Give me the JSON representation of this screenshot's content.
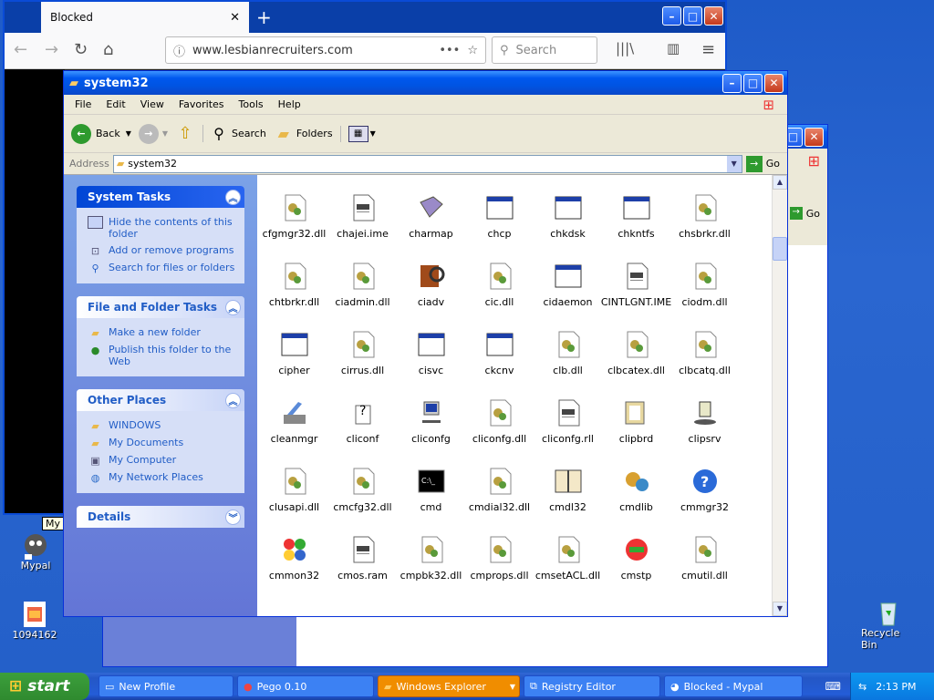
{
  "browser": {
    "tab_title": "Blocked",
    "url": "www.lesbianrecruiters.com",
    "search_placeholder": "Search"
  },
  "explorer": {
    "title": "system32",
    "menu": [
      "File",
      "Edit",
      "View",
      "Favorites",
      "Tools",
      "Help"
    ],
    "toolbar": {
      "back": "Back",
      "search": "Search",
      "folders": "Folders"
    },
    "address_label": "Address",
    "address_value": "system32",
    "go": "Go",
    "panels": {
      "system_tasks": {
        "title": "System Tasks",
        "items": [
          "Hide the contents of this folder",
          "Add or remove programs",
          "Search for files or folders"
        ]
      },
      "file_tasks": {
        "title": "File and Folder Tasks",
        "items": [
          "Make a new folder",
          "Publish this folder to the Web"
        ]
      },
      "other_places": {
        "title": "Other Places",
        "items": [
          "WINDOWS",
          "My Documents",
          "My Computer",
          "My Network Places"
        ]
      },
      "details": {
        "title": "Details"
      }
    },
    "files": [
      {
        "name": "cfgmgr32.dll",
        "icon": "dll"
      },
      {
        "name": "chajei.ime",
        "icon": "doc"
      },
      {
        "name": "charmap",
        "icon": "charmap"
      },
      {
        "name": "chcp",
        "icon": "window"
      },
      {
        "name": "chkdsk",
        "icon": "window"
      },
      {
        "name": "chkntfs",
        "icon": "window"
      },
      {
        "name": "chsbrkr.dll",
        "icon": "dll"
      },
      {
        "name": "chtbrkr.dll",
        "icon": "dll"
      },
      {
        "name": "ciadmin.dll",
        "icon": "dll"
      },
      {
        "name": "ciadv",
        "icon": "ciadv"
      },
      {
        "name": "cic.dll",
        "icon": "dll"
      },
      {
        "name": "cidaemon",
        "icon": "window"
      },
      {
        "name": "CINTLGNT.IME",
        "icon": "doc"
      },
      {
        "name": "ciodm.dll",
        "icon": "dll"
      },
      {
        "name": "cipher",
        "icon": "window"
      },
      {
        "name": "cirrus.dll",
        "icon": "dll"
      },
      {
        "name": "cisvc",
        "icon": "window"
      },
      {
        "name": "ckcnv",
        "icon": "window"
      },
      {
        "name": "clb.dll",
        "icon": "dll"
      },
      {
        "name": "clbcatex.dll",
        "icon": "dll"
      },
      {
        "name": "clbcatq.dll",
        "icon": "dll"
      },
      {
        "name": "cleanmgr",
        "icon": "cleanmgr"
      },
      {
        "name": "cliconf",
        "icon": "cliconf"
      },
      {
        "name": "cliconfg",
        "icon": "cliconfg"
      },
      {
        "name": "cliconfg.dll",
        "icon": "dll"
      },
      {
        "name": "cliconfg.rll",
        "icon": "doc"
      },
      {
        "name": "clipbrd",
        "icon": "clipbrd"
      },
      {
        "name": "clipsrv",
        "icon": "clipsrv"
      },
      {
        "name": "clusapi.dll",
        "icon": "dll"
      },
      {
        "name": "cmcfg32.dll",
        "icon": "dll"
      },
      {
        "name": "cmd",
        "icon": "cmd"
      },
      {
        "name": "cmdial32.dll",
        "icon": "dll"
      },
      {
        "name": "cmdl32",
        "icon": "cmdl32"
      },
      {
        "name": "cmdlib",
        "icon": "cmdlib"
      },
      {
        "name": "cmmgr32",
        "icon": "help"
      },
      {
        "name": "cmmon32",
        "icon": "cmmon"
      },
      {
        "name": "cmos.ram",
        "icon": "doc"
      },
      {
        "name": "cmpbk32.dll",
        "icon": "dll"
      },
      {
        "name": "cmprops.dll",
        "icon": "dll"
      },
      {
        "name": "cmsetACL.dll",
        "icon": "dll"
      },
      {
        "name": "cmstp",
        "icon": "cmstp"
      },
      {
        "name": "cmutil.dll",
        "icon": "dll"
      }
    ]
  },
  "back_window": {
    "go": "Go"
  },
  "desktop": {
    "icons": [
      {
        "label": "Mypal"
      },
      {
        "label": "1094162"
      },
      {
        "label": "Recycle Bin"
      }
    ],
    "tooltip": "My"
  },
  "taskbar": {
    "start": "start",
    "tasks": [
      "New Profile",
      "Pego 0.10",
      "Windows Explorer",
      "Registry Editor",
      "Blocked - Mypal"
    ],
    "clock": "2:13 PM"
  }
}
